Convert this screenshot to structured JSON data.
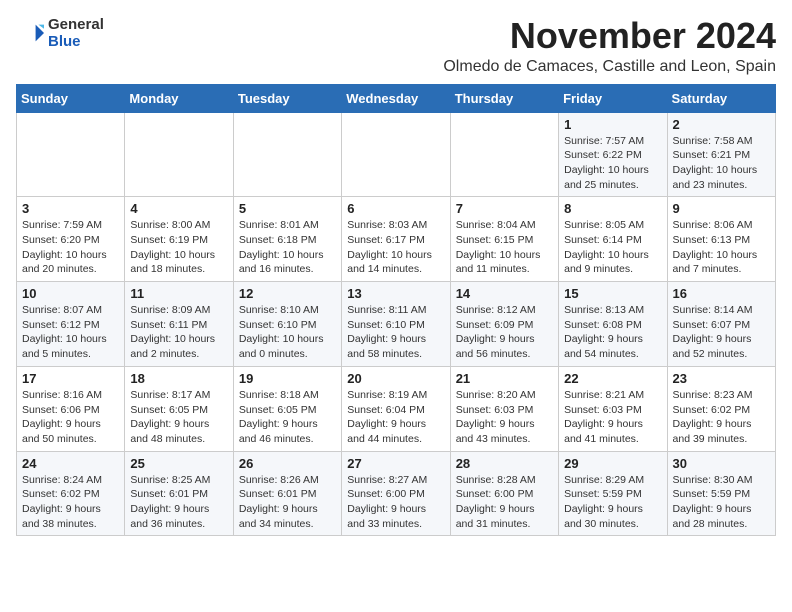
{
  "logo": {
    "general": "General",
    "blue": "Blue"
  },
  "header": {
    "month": "November 2024",
    "location": "Olmedo de Camaces, Castille and Leon, Spain"
  },
  "weekdays": [
    "Sunday",
    "Monday",
    "Tuesday",
    "Wednesday",
    "Thursday",
    "Friday",
    "Saturday"
  ],
  "weeks": [
    [
      {
        "day": "",
        "info": ""
      },
      {
        "day": "",
        "info": ""
      },
      {
        "day": "",
        "info": ""
      },
      {
        "day": "",
        "info": ""
      },
      {
        "day": "",
        "info": ""
      },
      {
        "day": "1",
        "info": "Sunrise: 7:57 AM\nSunset: 6:22 PM\nDaylight: 10 hours and 25 minutes."
      },
      {
        "day": "2",
        "info": "Sunrise: 7:58 AM\nSunset: 6:21 PM\nDaylight: 10 hours and 23 minutes."
      }
    ],
    [
      {
        "day": "3",
        "info": "Sunrise: 7:59 AM\nSunset: 6:20 PM\nDaylight: 10 hours and 20 minutes."
      },
      {
        "day": "4",
        "info": "Sunrise: 8:00 AM\nSunset: 6:19 PM\nDaylight: 10 hours and 18 minutes."
      },
      {
        "day": "5",
        "info": "Sunrise: 8:01 AM\nSunset: 6:18 PM\nDaylight: 10 hours and 16 minutes."
      },
      {
        "day": "6",
        "info": "Sunrise: 8:03 AM\nSunset: 6:17 PM\nDaylight: 10 hours and 14 minutes."
      },
      {
        "day": "7",
        "info": "Sunrise: 8:04 AM\nSunset: 6:15 PM\nDaylight: 10 hours and 11 minutes."
      },
      {
        "day": "8",
        "info": "Sunrise: 8:05 AM\nSunset: 6:14 PM\nDaylight: 10 hours and 9 minutes."
      },
      {
        "day": "9",
        "info": "Sunrise: 8:06 AM\nSunset: 6:13 PM\nDaylight: 10 hours and 7 minutes."
      }
    ],
    [
      {
        "day": "10",
        "info": "Sunrise: 8:07 AM\nSunset: 6:12 PM\nDaylight: 10 hours and 5 minutes."
      },
      {
        "day": "11",
        "info": "Sunrise: 8:09 AM\nSunset: 6:11 PM\nDaylight: 10 hours and 2 minutes."
      },
      {
        "day": "12",
        "info": "Sunrise: 8:10 AM\nSunset: 6:10 PM\nDaylight: 10 hours and 0 minutes."
      },
      {
        "day": "13",
        "info": "Sunrise: 8:11 AM\nSunset: 6:10 PM\nDaylight: 9 hours and 58 minutes."
      },
      {
        "day": "14",
        "info": "Sunrise: 8:12 AM\nSunset: 6:09 PM\nDaylight: 9 hours and 56 minutes."
      },
      {
        "day": "15",
        "info": "Sunrise: 8:13 AM\nSunset: 6:08 PM\nDaylight: 9 hours and 54 minutes."
      },
      {
        "day": "16",
        "info": "Sunrise: 8:14 AM\nSunset: 6:07 PM\nDaylight: 9 hours and 52 minutes."
      }
    ],
    [
      {
        "day": "17",
        "info": "Sunrise: 8:16 AM\nSunset: 6:06 PM\nDaylight: 9 hours and 50 minutes."
      },
      {
        "day": "18",
        "info": "Sunrise: 8:17 AM\nSunset: 6:05 PM\nDaylight: 9 hours and 48 minutes."
      },
      {
        "day": "19",
        "info": "Sunrise: 8:18 AM\nSunset: 6:05 PM\nDaylight: 9 hours and 46 minutes."
      },
      {
        "day": "20",
        "info": "Sunrise: 8:19 AM\nSunset: 6:04 PM\nDaylight: 9 hours and 44 minutes."
      },
      {
        "day": "21",
        "info": "Sunrise: 8:20 AM\nSunset: 6:03 PM\nDaylight: 9 hours and 43 minutes."
      },
      {
        "day": "22",
        "info": "Sunrise: 8:21 AM\nSunset: 6:03 PM\nDaylight: 9 hours and 41 minutes."
      },
      {
        "day": "23",
        "info": "Sunrise: 8:23 AM\nSunset: 6:02 PM\nDaylight: 9 hours and 39 minutes."
      }
    ],
    [
      {
        "day": "24",
        "info": "Sunrise: 8:24 AM\nSunset: 6:02 PM\nDaylight: 9 hours and 38 minutes."
      },
      {
        "day": "25",
        "info": "Sunrise: 8:25 AM\nSunset: 6:01 PM\nDaylight: 9 hours and 36 minutes."
      },
      {
        "day": "26",
        "info": "Sunrise: 8:26 AM\nSunset: 6:01 PM\nDaylight: 9 hours and 34 minutes."
      },
      {
        "day": "27",
        "info": "Sunrise: 8:27 AM\nSunset: 6:00 PM\nDaylight: 9 hours and 33 minutes."
      },
      {
        "day": "28",
        "info": "Sunrise: 8:28 AM\nSunset: 6:00 PM\nDaylight: 9 hours and 31 minutes."
      },
      {
        "day": "29",
        "info": "Sunrise: 8:29 AM\nSunset: 5:59 PM\nDaylight: 9 hours and 30 minutes."
      },
      {
        "day": "30",
        "info": "Sunrise: 8:30 AM\nSunset: 5:59 PM\nDaylight: 9 hours and 28 minutes."
      }
    ]
  ]
}
